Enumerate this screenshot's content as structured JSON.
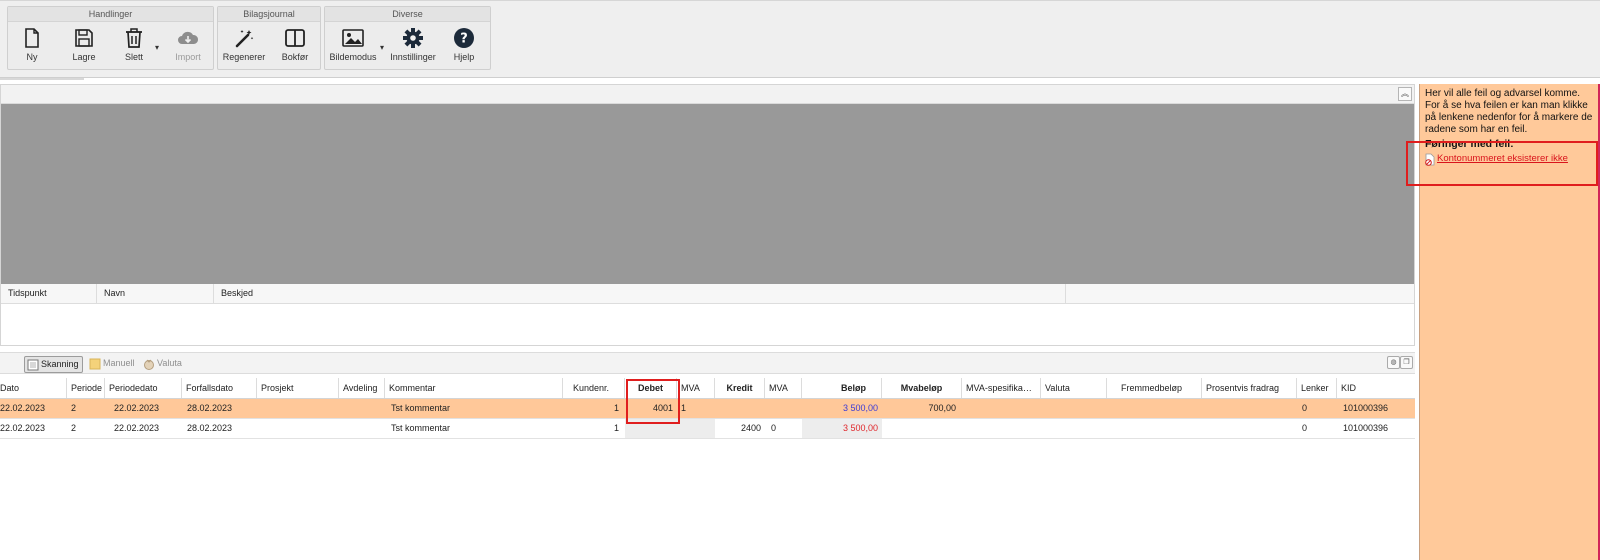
{
  "ribbon": {
    "groups": [
      {
        "title": "Handlinger",
        "buttons": [
          {
            "label": "Ny",
            "icon": "new-document-icon"
          },
          {
            "label": "Lagre",
            "icon": "floppy-disk-icon"
          },
          {
            "label": "Slett",
            "icon": "trash-icon",
            "dropdown": true
          },
          {
            "label": "Import",
            "icon": "cloud-download-icon",
            "disabled": true
          }
        ]
      },
      {
        "title": "Bilagsjournal",
        "buttons": [
          {
            "label": "Regenerer",
            "icon": "magic-wand-icon"
          },
          {
            "label": "Bokfør",
            "icon": "book-columns-icon"
          }
        ]
      },
      {
        "title": "Diverse",
        "buttons": [
          {
            "label": "Bildemodus",
            "icon": "image-icon",
            "dropdown": true
          },
          {
            "label": "Innstillinger",
            "icon": "gear-icon"
          },
          {
            "label": "Hjelp",
            "icon": "help-circle-icon"
          }
        ]
      }
    ]
  },
  "log": {
    "columns": [
      "Tidspunkt",
      "Navn",
      "Beskjed"
    ]
  },
  "entry_toolbar": {
    "buttons": [
      {
        "label": "Skanning",
        "icon": "scanner-icon",
        "active": true
      },
      {
        "label": "Manuell",
        "icon": "manual-icon",
        "active": false
      },
      {
        "label": "Valuta",
        "icon": "currency-icon",
        "active": false
      }
    ]
  },
  "grid": {
    "columns": [
      "Dato",
      "Periode",
      "Periodedato",
      "Forfallsdato",
      "Prosjekt",
      "Avdeling",
      "Kommentar",
      "Kundenr.",
      "Debet",
      "MVA",
      "Kredit",
      "MVA",
      "Beløp",
      "Mvabeløp",
      "MVA-spesifika…",
      "Valuta",
      "Fremmedbeløp",
      "Prosentvis fradrag",
      "Lenker",
      "KID"
    ],
    "rows": [
      {
        "dato": "22.02.2023",
        "periode": "2",
        "periodedato": "22.02.2023",
        "forfallsdato": "28.02.2023",
        "prosjekt": "",
        "avdeling": "",
        "kommentar": "Tst kommentar",
        "kundenr": "1",
        "debet": "4001",
        "debet_mva": "1",
        "kredit": "",
        "kredit_mva": "",
        "belop": "3 500,00",
        "mvabelop": "700,00",
        "mva_spes": "",
        "valuta": "",
        "fremmedbelop": "",
        "prosent": "",
        "lenker": "0",
        "kid": "101000396"
      },
      {
        "dato": "22.02.2023",
        "periode": "2",
        "periodedato": "22.02.2023",
        "forfallsdato": "28.02.2023",
        "prosjekt": "",
        "avdeling": "",
        "kommentar": "Tst kommentar",
        "kundenr": "1",
        "debet": "",
        "debet_mva": "",
        "kredit": "2400",
        "kredit_mva": "0",
        "belop": "3 500,00",
        "mvabelop": "",
        "mva_spes": "",
        "valuta": "",
        "fremmedbelop": "",
        "prosent": "",
        "lenker": "0",
        "kid": "101000396"
      }
    ]
  },
  "errors": {
    "intro": "Her vil alle feil og advarsel komme. For å se hva feilen er kan man klikke på lenkene nedenfor for å markere de radene som har en feil.",
    "heading": "Føringer med feil:",
    "items": [
      {
        "text": "Kontonummeret eksisterer ikke",
        "icon": "error-document-icon"
      }
    ]
  },
  "colors": {
    "selected_row": "#ffc899",
    "error_panel": "#ffc99a",
    "highlight_box": "#e01e1e",
    "amount_blue": "#3b3bd6",
    "amount_red": "#e0272b"
  }
}
